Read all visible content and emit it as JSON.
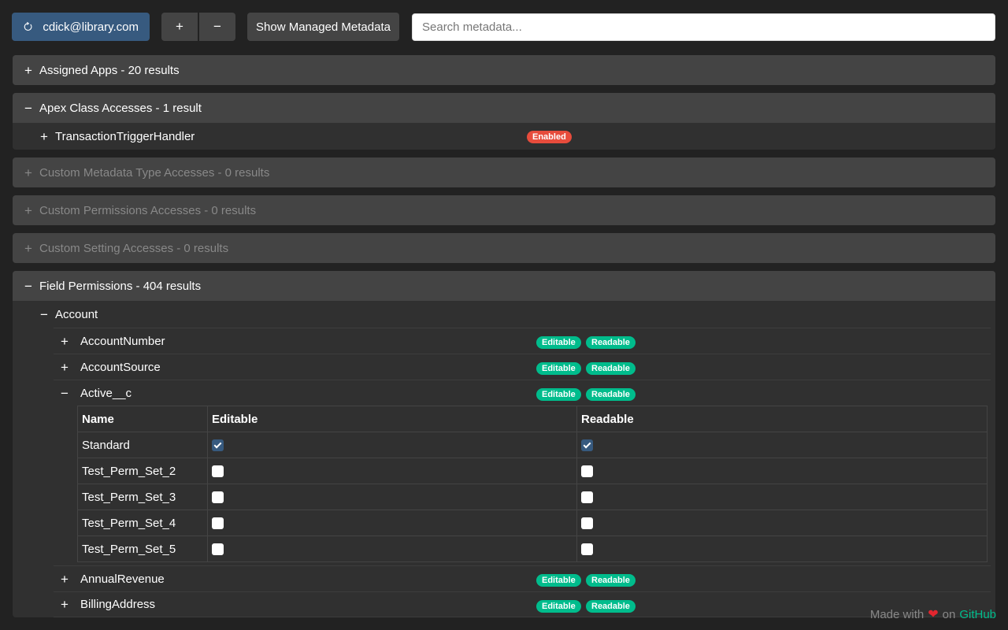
{
  "toolbar": {
    "user_label": "cdick@library.com",
    "expand_label": "+",
    "collapse_label": "−",
    "managed_label": "Show Managed Metadata",
    "search_placeholder": "Search metadata...",
    "search_value": ""
  },
  "sections": {
    "assigned_apps": {
      "toggle": "+",
      "label": "Assigned Apps - 20 results"
    },
    "apex": {
      "toggle": "−",
      "label": "Apex Class Accesses - 1 result",
      "items": [
        {
          "toggle": "+",
          "name": "TransactionTriggerHandler",
          "badge": "Enabled"
        }
      ]
    },
    "custom_metadata": {
      "toggle": "+",
      "label": "Custom Metadata Type Accesses - 0 results"
    },
    "custom_permissions": {
      "toggle": "+",
      "label": "Custom Permissions Accesses - 0 results"
    },
    "custom_setting": {
      "toggle": "+",
      "label": "Custom Setting Accesses - 0 results"
    },
    "field_permissions": {
      "toggle": "−",
      "label": "Field Permissions - 404 results",
      "object": {
        "toggle": "−",
        "name": "Account"
      },
      "fields": [
        {
          "toggle": "+",
          "name": "AccountNumber",
          "badges": [
            "Editable",
            "Readable"
          ]
        },
        {
          "toggle": "+",
          "name": "AccountSource",
          "badges": [
            "Editable",
            "Readable"
          ]
        },
        {
          "toggle": "−",
          "name": "Active__c",
          "badges": [
            "Editable",
            "Readable"
          ]
        },
        {
          "toggle": "+",
          "name": "AnnualRevenue",
          "badges": [
            "Editable",
            "Readable"
          ]
        },
        {
          "toggle": "+",
          "name": "BillingAddress",
          "badges": [
            "Editable",
            "Readable"
          ]
        }
      ],
      "table": {
        "headers": [
          "Name",
          "Editable",
          "Readable"
        ],
        "rows": [
          {
            "name": "Standard",
            "editable": true,
            "readable": true
          },
          {
            "name": "Test_Perm_Set_2",
            "editable": false,
            "readable": false
          },
          {
            "name": "Test_Perm_Set_3",
            "editable": false,
            "readable": false
          },
          {
            "name": "Test_Perm_Set_4",
            "editable": false,
            "readable": false
          },
          {
            "name": "Test_Perm_Set_5",
            "editable": false,
            "readable": false
          }
        ]
      }
    }
  },
  "footer": {
    "made_with": "Made with",
    "on": "on",
    "link": "GitHub"
  },
  "colors": {
    "primary": "#375a7f",
    "success": "#00bc8c",
    "danger": "#e74c3c",
    "background": "#222222"
  }
}
